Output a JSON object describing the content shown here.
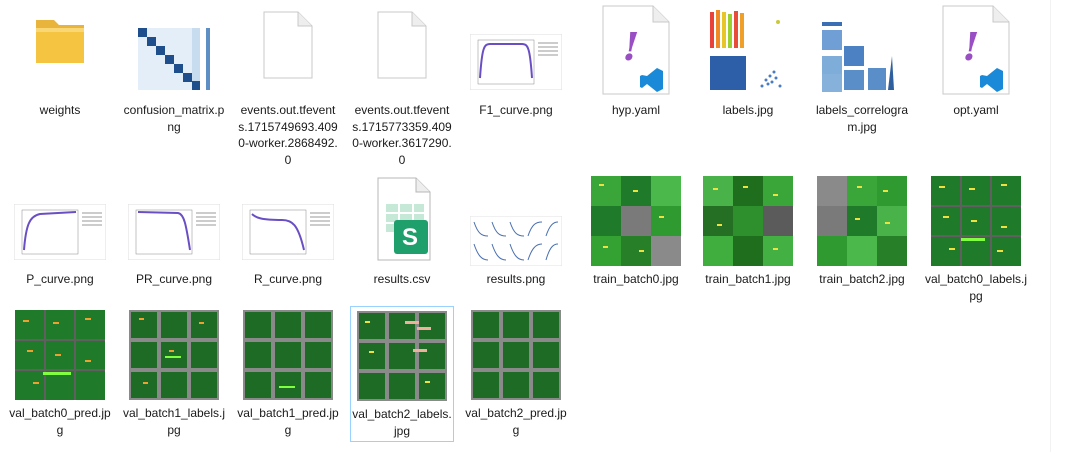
{
  "files": [
    {
      "name": "weights",
      "kind": "folder"
    },
    {
      "name": "confusion_matrix.png",
      "kind": "matrix"
    },
    {
      "name": "events.out.tfevents.1715749693.4090-worker.2868492.0",
      "kind": "blank"
    },
    {
      "name": "events.out.tfevents.1715773359.4090-worker.3617290.0",
      "kind": "blank"
    },
    {
      "name": "F1_curve.png",
      "kind": "curve"
    },
    {
      "name": "hyp.yaml",
      "kind": "yaml"
    },
    {
      "name": "labels.jpg",
      "kind": "labels"
    },
    {
      "name": "labels_correlogram.jpg",
      "kind": "correlogram"
    },
    {
      "name": "opt.yaml",
      "kind": "yaml"
    },
    {
      "name": "P_curve.png",
      "kind": "curve"
    },
    {
      "name": "PR_curve.png",
      "kind": "curve"
    },
    {
      "name": "R_curve.png",
      "kind": "curve"
    },
    {
      "name": "results.csv",
      "kind": "csv"
    },
    {
      "name": "results.png",
      "kind": "results"
    },
    {
      "name": "train_batch0.jpg",
      "kind": "photo"
    },
    {
      "name": "train_batch1.jpg",
      "kind": "photo"
    },
    {
      "name": "train_batch2.jpg",
      "kind": "photo"
    },
    {
      "name": "val_batch0_labels.jpg",
      "kind": "photo"
    },
    {
      "name": "val_batch0_pred.jpg",
      "kind": "photo"
    },
    {
      "name": "val_batch1_labels.jpg",
      "kind": "photo"
    },
    {
      "name": "val_batch1_pred.jpg",
      "kind": "photo"
    },
    {
      "name": "val_batch2_labels.jpg",
      "kind": "photo"
    },
    {
      "name": "val_batch2_pred.jpg",
      "kind": "photo"
    }
  ],
  "csv_letter": "S",
  "yaml_glyph": "!",
  "selected": "val_batch2_labels.jpg",
  "colors": {
    "selection_border": "#99d1ff",
    "folder": "#f5c542",
    "csv_green": "#1f9f6c",
    "yaml_purple": "#9a4ec3",
    "vscode_blue": "#1a8ad8",
    "photo_green": "#1f7a2a"
  }
}
